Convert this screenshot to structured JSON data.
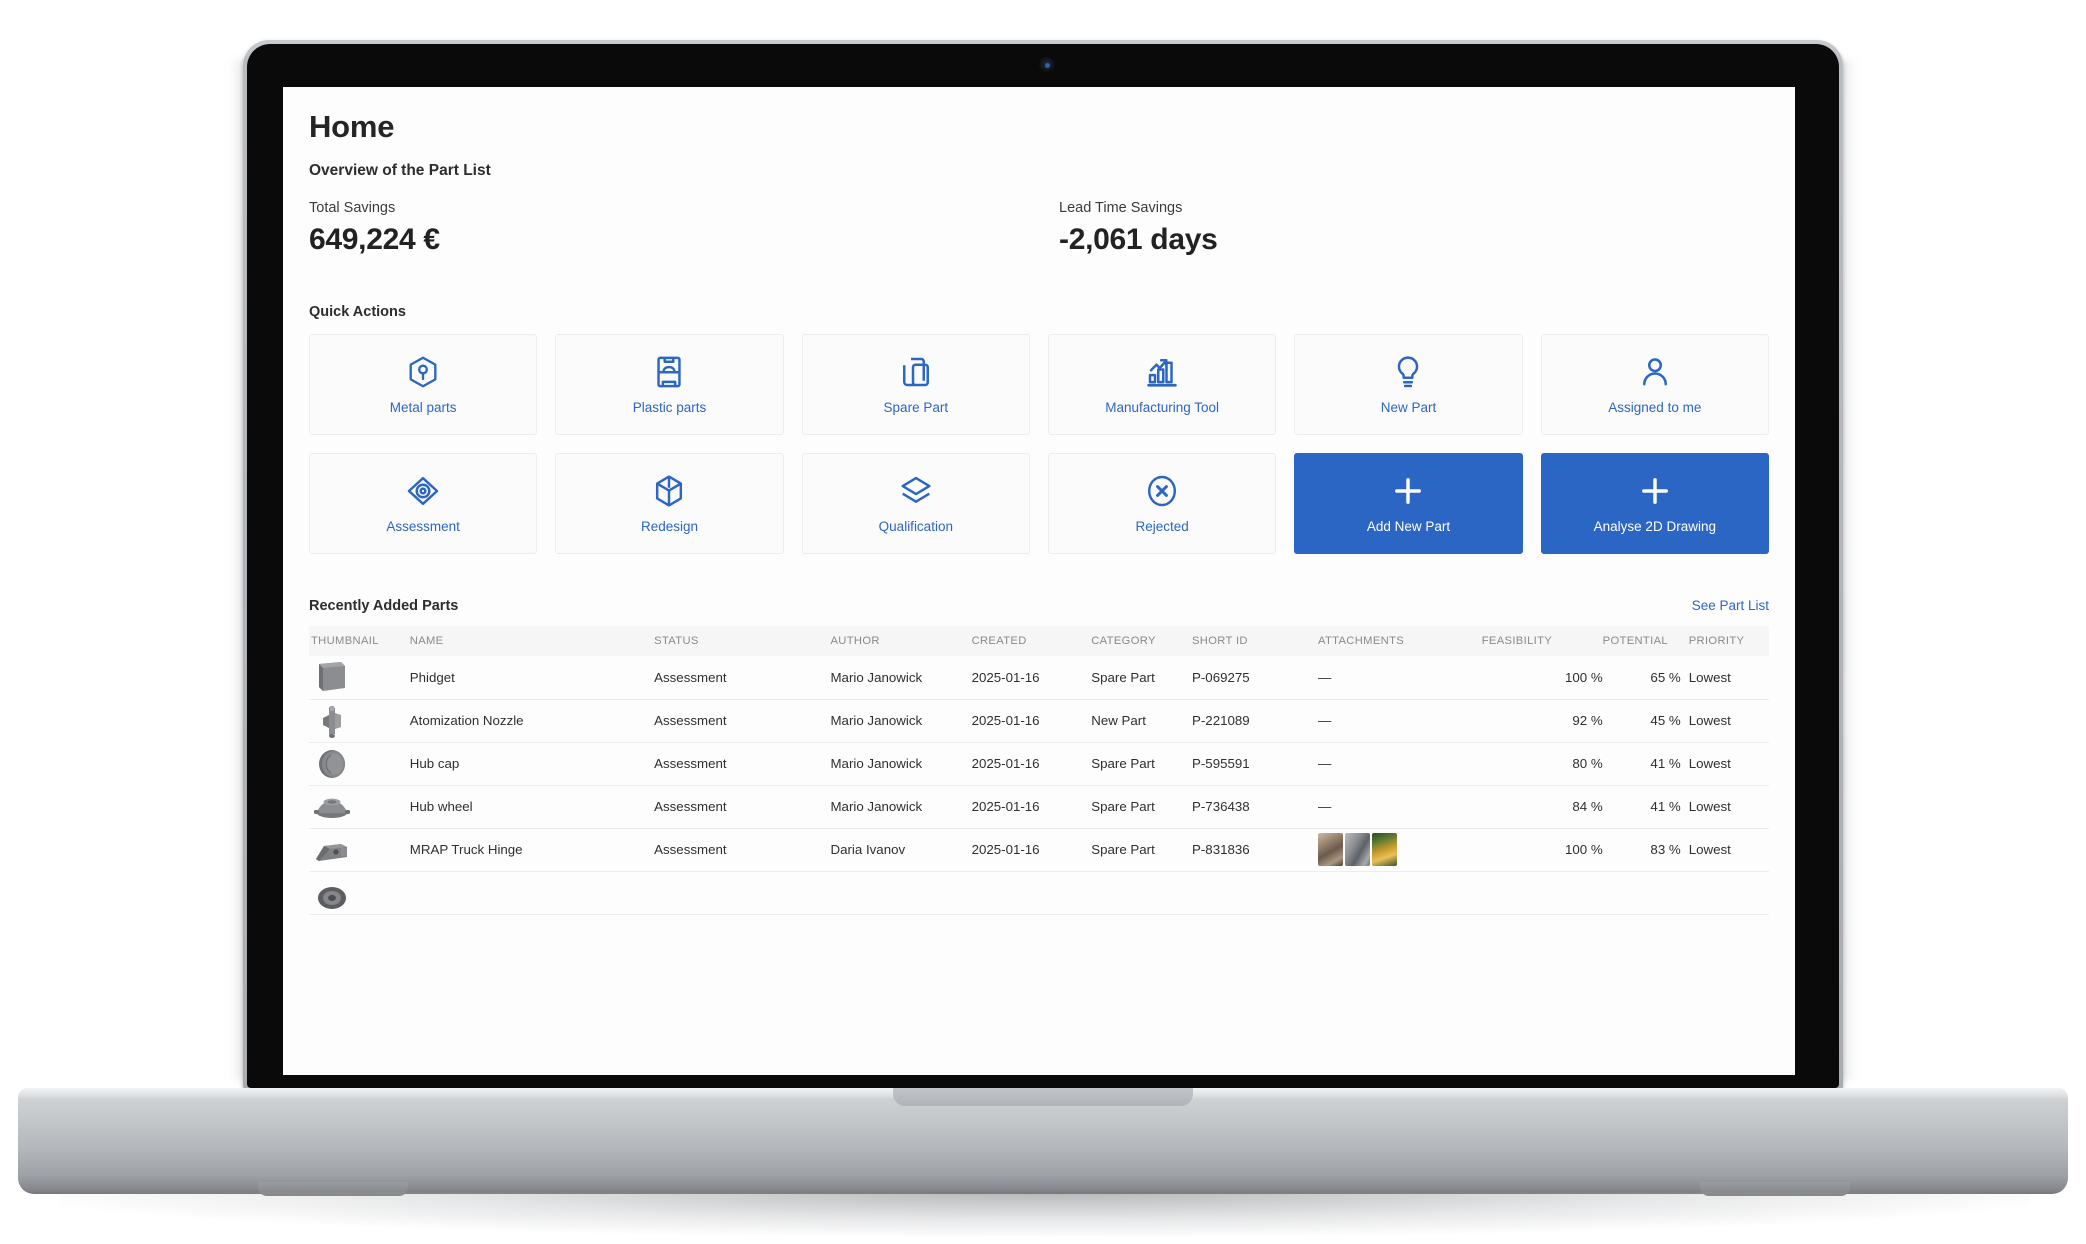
{
  "page": {
    "title": "Home",
    "subtitle": "Overview of the Part List"
  },
  "kpis": [
    {
      "label": "Total Savings",
      "value": "649,224 €"
    },
    {
      "label": "Lead Time Savings",
      "value": "-2,061 days"
    }
  ],
  "quick_actions": {
    "section_label": "Quick Actions",
    "tiles": [
      {
        "label": "Metal parts",
        "icon": "metal-part-hexagon-icon",
        "primary": false
      },
      {
        "label": "Plastic parts",
        "icon": "plastic-mold-icon",
        "primary": false
      },
      {
        "label": "Spare Part",
        "icon": "copy-documents-icon",
        "primary": false
      },
      {
        "label": "Manufacturing Tool",
        "icon": "bar-chart-arrow-icon",
        "primary": false
      },
      {
        "label": "New Part",
        "icon": "lightbulb-icon",
        "primary": false
      },
      {
        "label": "Assigned to me",
        "icon": "person-icon",
        "primary": false
      },
      {
        "label": "Assessment",
        "icon": "target-eye-icon",
        "primary": false
      },
      {
        "label": "Redesign",
        "icon": "cube-3d-icon",
        "primary": false
      },
      {
        "label": "Qualification",
        "icon": "layers-stack-icon",
        "primary": false
      },
      {
        "label": "Rejected",
        "icon": "circle-x-icon",
        "primary": false
      },
      {
        "label": "Add New Part",
        "icon": "plus-icon",
        "primary": true
      },
      {
        "label": "Analyse 2D Drawing",
        "icon": "plus-icon",
        "primary": true
      }
    ]
  },
  "recent_parts": {
    "title": "Recently Added Parts",
    "see_part_list": "See Part List",
    "columns": [
      "THUMBNAIL",
      "NAME",
      "STATUS",
      "AUTHOR",
      "CREATED",
      "CATEGORY",
      "SHORT ID",
      "ATTACHMENTS",
      "FEASIBILITY",
      "POTENTIAL",
      "PRIORITY"
    ],
    "rows": [
      {
        "thumbnail": "flat-panel-part",
        "name": "Phidget",
        "status": "Assessment",
        "author": "Mario Janowick",
        "created": "2025-01-16",
        "category": "Spare Part",
        "short_id": "P-069275",
        "attachments": "—",
        "attachment_images": 0,
        "feasibility": "100 %",
        "potential": "65 %",
        "priority": "Lowest"
      },
      {
        "thumbnail": "nozzle-part",
        "name": "Atomization Nozzle",
        "status": "Assessment",
        "author": "Mario Janowick",
        "created": "2025-01-16",
        "category": "New Part",
        "short_id": "P-221089",
        "attachments": "—",
        "attachment_images": 0,
        "feasibility": "92 %",
        "potential": "45 %",
        "priority": "Lowest"
      },
      {
        "thumbnail": "hub-cap-part",
        "name": "Hub cap",
        "status": "Assessment",
        "author": "Mario Janowick",
        "created": "2025-01-16",
        "category": "Spare Part",
        "short_id": "P-595591",
        "attachments": "—",
        "attachment_images": 0,
        "feasibility": "80 %",
        "potential": "41 %",
        "priority": "Lowest"
      },
      {
        "thumbnail": "hub-wheel-part",
        "name": "Hub wheel",
        "status": "Assessment",
        "author": "Mario Janowick",
        "created": "2025-01-16",
        "category": "Spare Part",
        "short_id": "P-736438",
        "attachments": "—",
        "attachment_images": 0,
        "feasibility": "84 %",
        "potential": "41 %",
        "priority": "Lowest"
      },
      {
        "thumbnail": "truck-hinge-part",
        "name": "MRAP Truck Hinge",
        "status": "Assessment",
        "author": "Daria Ivanov",
        "created": "2025-01-16",
        "category": "Spare Part",
        "short_id": "P-831836",
        "attachments": "",
        "attachment_images": 3,
        "feasibility": "100 %",
        "potential": "83 %",
        "priority": "Lowest"
      }
    ]
  },
  "colors": {
    "accent": "#2c66c4",
    "text": "#2f2f2f",
    "muted": "#8a8a8a",
    "tile_bg": "#fbfbfb",
    "header_bg": "#f6f6f6"
  }
}
